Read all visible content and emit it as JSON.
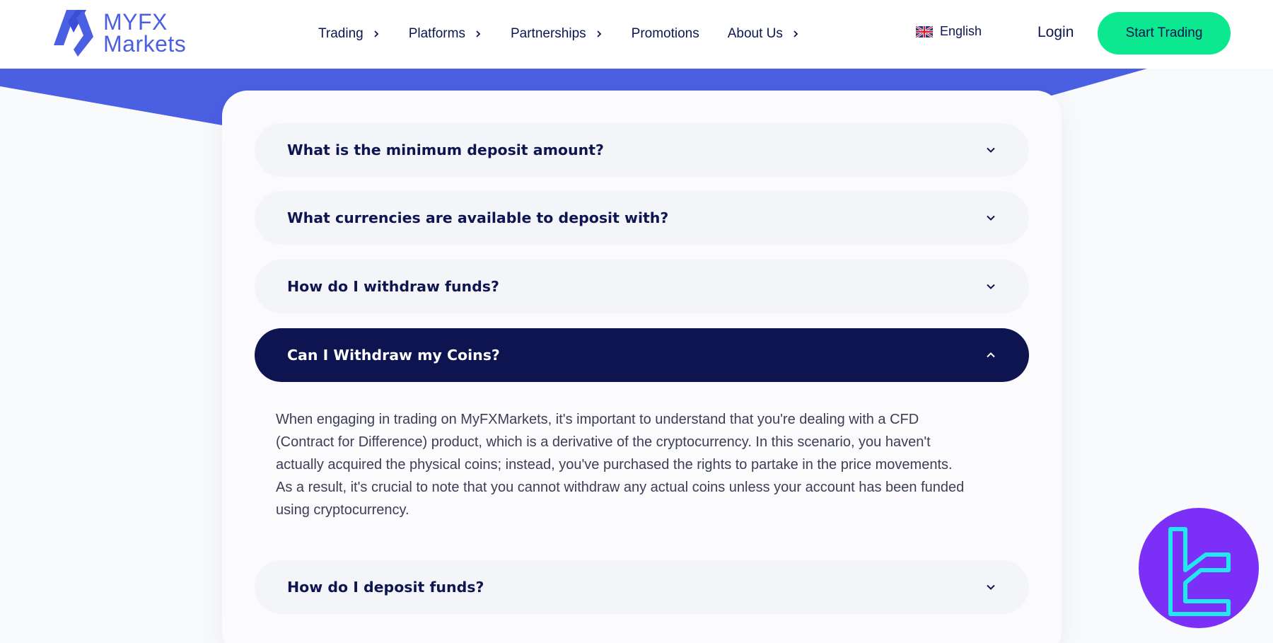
{
  "header": {
    "logo": {
      "line1": "MYFX",
      "line2": "Markets"
    },
    "nav": [
      {
        "label": "Trading",
        "has_chevron": true
      },
      {
        "label": "Platforms",
        "has_chevron": true
      },
      {
        "label": "Partnerships",
        "has_chevron": true
      },
      {
        "label": "Promotions",
        "has_chevron": false
      },
      {
        "label": "About Us",
        "has_chevron": true
      }
    ],
    "language": {
      "label": "English",
      "flag_icon": "uk-flag-icon"
    },
    "login_label": "Login",
    "cta_label": "Start Trading"
  },
  "faq": {
    "items": [
      {
        "question": "What is the minimum deposit amount?",
        "expanded": false
      },
      {
        "question": "What currencies are available to deposit with?",
        "expanded": false
      },
      {
        "question": "How do I withdraw funds?",
        "expanded": false
      },
      {
        "question": "Can I Withdraw my Coins?",
        "expanded": true
      },
      {
        "question": "How do I deposit funds?",
        "expanded": false
      }
    ],
    "answer_lines": [
      "When engaging in trading on MyFXMarkets, it's important to understand that you're dealing with a CFD",
      "(Contract for Difference) product, which is a derivative of the cryptocurrency. In this scenario, you haven't",
      "actually acquired the physical coins; instead, you've purchased the rights to partake in the price movements.",
      "As a result, it's crucial to note that you cannot withdraw any actual coins unless your account has been funded",
      "using cryptocurrency."
    ]
  },
  "colors": {
    "brand_blue": "#4b5fe3",
    "navy": "#0e1450",
    "cta_green": "#0ce88f",
    "badge_purple": "#7b2ff7",
    "badge_cyan": "#22e6f0"
  }
}
